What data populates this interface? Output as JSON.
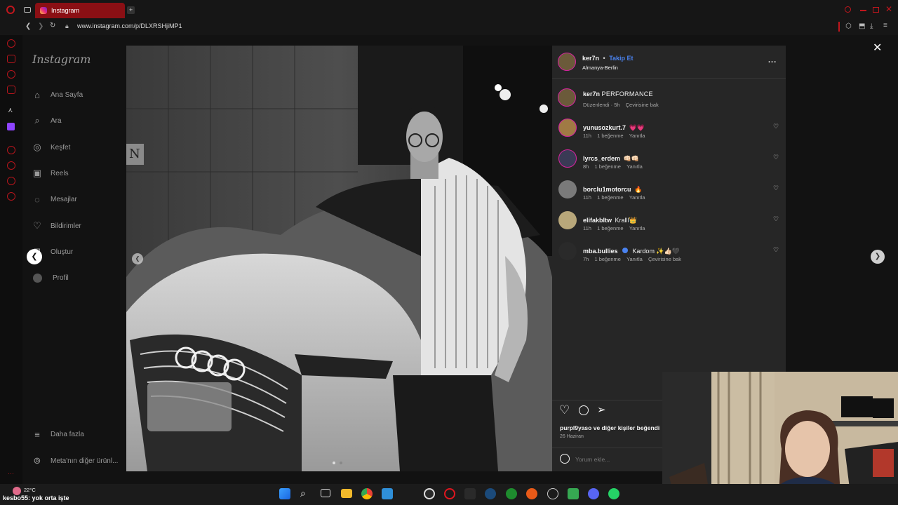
{
  "browser": {
    "tab_title": "Instagram",
    "url": "www.instagram.com/p/DLXRSHjiMP1"
  },
  "instagram": {
    "logo": "Instagram",
    "nav": [
      {
        "label": "Ana Sayfa",
        "icon": "home-icon"
      },
      {
        "label": "Ara",
        "icon": "search-icon"
      },
      {
        "label": "Keşfet",
        "icon": "compass-icon"
      },
      {
        "label": "Reels",
        "icon": "reels-icon"
      },
      {
        "label": "Mesajlar",
        "icon": "messenger-icon"
      },
      {
        "label": "Bildirimler",
        "icon": "heart-icon"
      },
      {
        "label": "Oluştur",
        "icon": "plus-icon"
      },
      {
        "label": "Profil",
        "icon": "avatar-icon"
      }
    ],
    "more_label": "Daha fazla",
    "meta_label": "Meta'nın diğer ürünl..."
  },
  "post": {
    "username": "ker7n",
    "separator": "•",
    "follow_label": "Takip Et",
    "location": "Almanya-Berlin",
    "more_dots": "...",
    "caption": {
      "username": "ker7n",
      "text": "PERFORMANCE",
      "edited": "Düzenlendi · 5h",
      "translate": "Çevirisine bak"
    },
    "comments": [
      {
        "username": "yunusozkurt.7",
        "text": "💗💗",
        "time": "11h",
        "likes": "1 beğenme",
        "reply": "Yanıtla",
        "translate": ""
      },
      {
        "username": "lyrcs_erdem",
        "text": "👊🏻👊🏻",
        "time": "8h",
        "likes": "1 beğenme",
        "reply": "Yanıtla",
        "translate": ""
      },
      {
        "username": "borclu1motorcu",
        "text": "🔥",
        "time": "11h",
        "likes": "1 beğenme",
        "reply": "Yanıtla",
        "translate": ""
      },
      {
        "username": "elifakbltw",
        "text": "Kralll👑",
        "time": "11h",
        "likes": "1 beğenme",
        "reply": "Yanıtla",
        "translate": ""
      },
      {
        "username": "mba.bullies",
        "text": "Kardom ✨👍🏻🖤",
        "time": "7h",
        "likes": "1 beğenme",
        "reply": "Yanıtla",
        "translate": "Çevirisine bak"
      }
    ],
    "liked_by_user": "purpl9yaso",
    "liked_by_rest": "ve diğer kişiler beğendi",
    "date": "26 Haziran",
    "comment_placeholder": "Yorum ekle..."
  },
  "taskbar": {
    "temperature": "22°C",
    "ticker": "kesbo55: yok orta işte"
  },
  "colors": {
    "accent_blue": "#4a83f0",
    "opera_red": "#b8151c",
    "tab_red": "#8b0f14"
  }
}
